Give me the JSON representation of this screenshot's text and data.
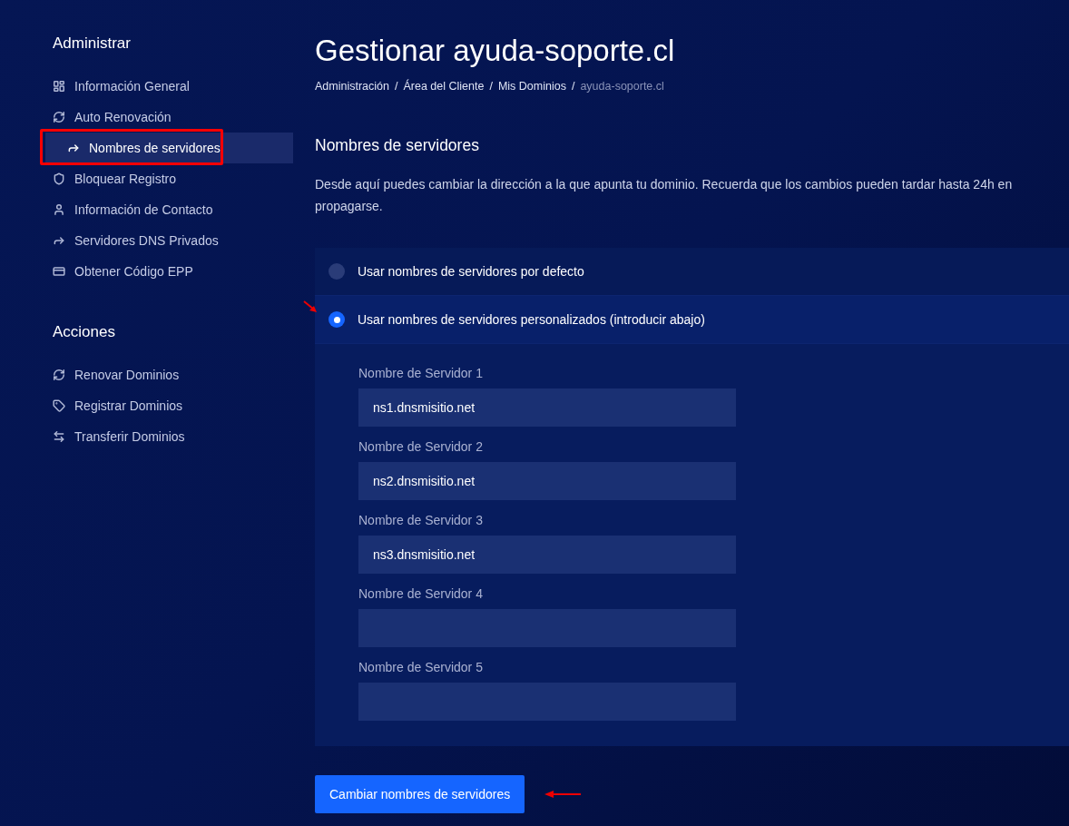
{
  "sidebar": {
    "sections": [
      {
        "title": "Administrar",
        "items": [
          {
            "label": "Información General",
            "kind": "dashboard",
            "selected": false
          },
          {
            "label": "Auto Renovación",
            "kind": "refresh",
            "selected": false
          },
          {
            "label": "Nombres de servidores",
            "kind": "share",
            "selected": true
          },
          {
            "label": "Bloquear Registro",
            "kind": "shield",
            "selected": false
          },
          {
            "label": "Información de Contacto",
            "kind": "user",
            "selected": false
          },
          {
            "label": "Servidores DNS Privados",
            "kind": "share",
            "selected": false
          },
          {
            "label": "Obtener Código EPP",
            "kind": "card",
            "selected": false
          }
        ]
      },
      {
        "title": "Acciones",
        "items": [
          {
            "label": "Renovar Dominios",
            "kind": "refresh",
            "selected": false
          },
          {
            "label": "Registrar Dominios",
            "kind": "tag",
            "selected": false
          },
          {
            "label": "Transferir Dominios",
            "kind": "transfer",
            "selected": false
          }
        ]
      }
    ]
  },
  "page": {
    "title": "Gestionar ayuda-soporte.cl",
    "breadcrumb": [
      {
        "label": "Administración",
        "separator": "/"
      },
      {
        "label": "Área del Cliente",
        "separator": "/"
      },
      {
        "label": "Mis Dominios",
        "separator": "/"
      },
      {
        "label": "ayuda-soporte.cl"
      }
    ]
  },
  "section": {
    "title": "Nombres de servidores",
    "description": "Desde aquí puedes cambiar la dirección a la que apunta tu dominio. Recuerda que los cambios pueden tardar hasta 24h en propagarse."
  },
  "options": [
    {
      "label": "Usar nombres de servidores por defecto",
      "selected": false
    },
    {
      "label": "Usar nombres de servidores personalizados (introducir abajo)",
      "selected": true
    }
  ],
  "nameservers": [
    {
      "label": "Nombre de Servidor 1",
      "value": "ns1.dnsmisitio.net"
    },
    {
      "label": "Nombre de Servidor 2",
      "value": "ns2.dnsmisitio.net"
    },
    {
      "label": "Nombre de Servidor 3",
      "value": "ns3.dnsmisitio.net"
    },
    {
      "label": "Nombre de Servidor 4"
    },
    {
      "label": "Nombre de Servidor 5"
    }
  ],
  "submit": "Cambiar nombres de servidores"
}
